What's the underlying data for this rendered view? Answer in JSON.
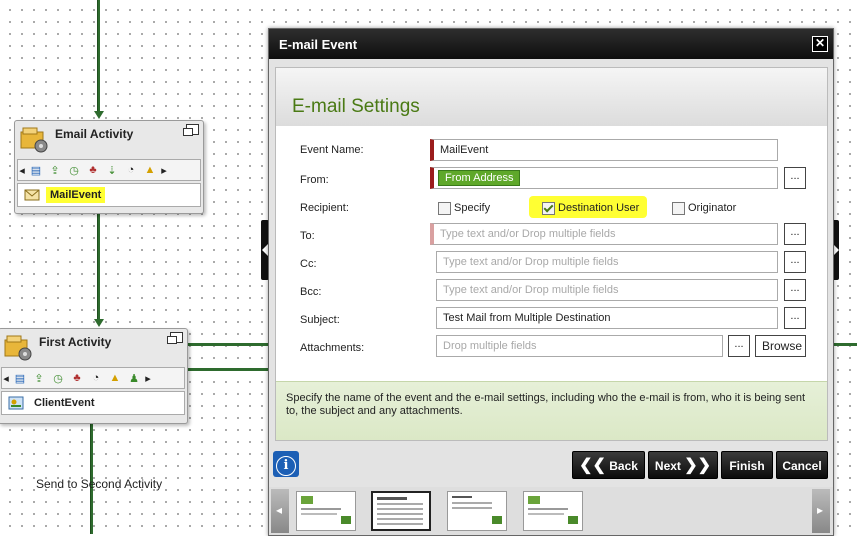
{
  "canvas": {
    "email_activity": {
      "title": "Email Activity",
      "event_label": "MailEvent"
    },
    "first_activity": {
      "title": "First Activity",
      "event_label": "ClientEvent"
    },
    "line_label": "Send to Second Activity"
  },
  "dialog": {
    "title": "E-mail Event",
    "close": "✕",
    "heading": "E-mail Settings",
    "fields": {
      "event_name": {
        "label": "Event Name:",
        "value": "MailEvent"
      },
      "from": {
        "label": "From:",
        "value": "From Address"
      },
      "recipient": {
        "label": "Recipient:",
        "options": [
          {
            "label": "Specify",
            "checked": false
          },
          {
            "label": "Destination User",
            "checked": true
          },
          {
            "label": "Originator",
            "checked": false
          }
        ]
      },
      "to": {
        "label": "To:",
        "placeholder": "Type text and/or Drop multiple fields"
      },
      "cc": {
        "label": "Cc:",
        "placeholder": "Type text and/or Drop multiple fields"
      },
      "bcc": {
        "label": "Bcc:",
        "placeholder": "Type text and/or Drop multiple fields"
      },
      "subject": {
        "label": "Subject:",
        "value": "Test Mail from Multiple Destination"
      },
      "attachments": {
        "label": "Attachments:",
        "placeholder": "Drop multiple fields"
      }
    },
    "dots_label": "...",
    "browse_label": "Browse",
    "help_text": "Specify the name of the event and the e-mail settings, including who the e-mail is from, who it is being sent to, the subject and any attachments.",
    "buttons": {
      "info": "i",
      "back": "Back",
      "next": "Next",
      "finish": "Finish",
      "cancel": "Cancel"
    }
  },
  "colors": {
    "accent_green": "#4a7a14",
    "required_marker": "#9b1c1c",
    "highlight": "#ffff33",
    "from_tag": "#5fa82a"
  }
}
